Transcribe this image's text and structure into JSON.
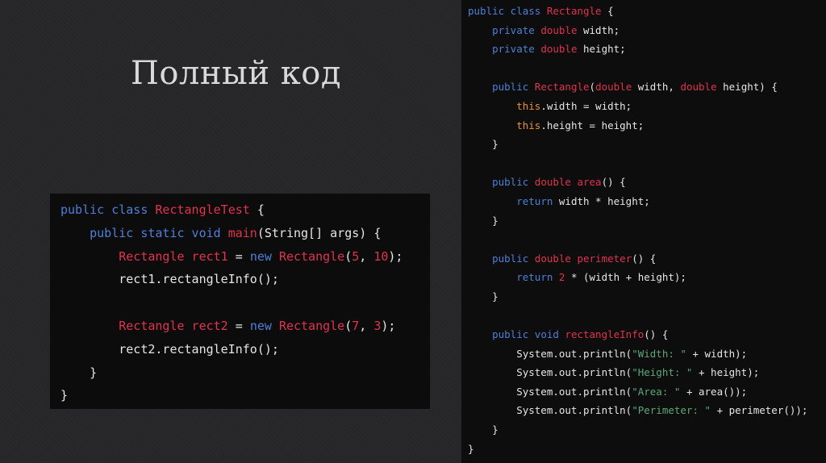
{
  "title": "Полный код",
  "colors": {
    "background": "#262528",
    "panel": "#0c0c0c",
    "keyword": "#4f7fd6",
    "type": "#e0334d",
    "this": "#e8912e",
    "string": "#5aa77a",
    "text": "#e6e6e6"
  },
  "left_code": [
    [
      [
        "kw",
        "public class "
      ],
      [
        "type",
        "RectangleTest"
      ],
      [
        "plain",
        " {"
      ]
    ],
    [
      [
        "plain",
        "    "
      ],
      [
        "kw",
        "public static void "
      ],
      [
        "fn",
        "main"
      ],
      [
        "plain",
        "(String[] args) {"
      ]
    ],
    [
      [
        "plain",
        "        "
      ],
      [
        "type",
        "Rectangle rect1"
      ],
      [
        "plain",
        " = "
      ],
      [
        "kw",
        "new "
      ],
      [
        "type",
        "Rectangle"
      ],
      [
        "plain",
        "("
      ],
      [
        "num",
        "5"
      ],
      [
        "plain",
        ", "
      ],
      [
        "num",
        "10"
      ],
      [
        "plain",
        ");"
      ]
    ],
    [
      [
        "plain",
        "        rect1.rectangleInfo();"
      ]
    ],
    [],
    [
      [
        "plain",
        "        "
      ],
      [
        "type",
        "Rectangle rect2"
      ],
      [
        "plain",
        " = "
      ],
      [
        "kw",
        "new "
      ],
      [
        "type",
        "Rectangle"
      ],
      [
        "plain",
        "("
      ],
      [
        "num",
        "7"
      ],
      [
        "plain",
        ", "
      ],
      [
        "num",
        "3"
      ],
      [
        "plain",
        ");"
      ]
    ],
    [
      [
        "plain",
        "        rect2.rectangleInfo();"
      ]
    ],
    [
      [
        "plain",
        "    }"
      ]
    ],
    [
      [
        "plain",
        "}"
      ]
    ]
  ],
  "right_code": [
    [
      [
        "kw",
        "public class "
      ],
      [
        "type",
        "Rectangle"
      ],
      [
        "plain",
        " {"
      ]
    ],
    [
      [
        "plain",
        "    "
      ],
      [
        "kw",
        "private "
      ],
      [
        "type",
        "double"
      ],
      [
        "plain",
        " width;"
      ]
    ],
    [
      [
        "plain",
        "    "
      ],
      [
        "kw",
        "private "
      ],
      [
        "type",
        "double"
      ],
      [
        "plain",
        " height;"
      ]
    ],
    [],
    [
      [
        "plain",
        "    "
      ],
      [
        "kw",
        "public "
      ],
      [
        "type",
        "Rectangle"
      ],
      [
        "plain",
        "("
      ],
      [
        "type",
        "double"
      ],
      [
        "plain",
        " width, "
      ],
      [
        "type",
        "double"
      ],
      [
        "plain",
        " height) {"
      ]
    ],
    [
      [
        "plain",
        "        "
      ],
      [
        "this",
        "this"
      ],
      [
        "plain",
        ".width = width;"
      ]
    ],
    [
      [
        "plain",
        "        "
      ],
      [
        "this",
        "this"
      ],
      [
        "plain",
        ".height = height;"
      ]
    ],
    [
      [
        "plain",
        "    }"
      ]
    ],
    [],
    [
      [
        "plain",
        "    "
      ],
      [
        "kw",
        "public "
      ],
      [
        "type",
        "double "
      ],
      [
        "fn",
        "area"
      ],
      [
        "plain",
        "() {"
      ]
    ],
    [
      [
        "plain",
        "        "
      ],
      [
        "kw",
        "return"
      ],
      [
        "plain",
        " width * height;"
      ]
    ],
    [
      [
        "plain",
        "    }"
      ]
    ],
    [],
    [
      [
        "plain",
        "    "
      ],
      [
        "kw",
        "public "
      ],
      [
        "type",
        "double "
      ],
      [
        "fn",
        "perimeter"
      ],
      [
        "plain",
        "() {"
      ]
    ],
    [
      [
        "plain",
        "        "
      ],
      [
        "kw",
        "return "
      ],
      [
        "num",
        "2"
      ],
      [
        "plain",
        " * (width + height);"
      ]
    ],
    [
      [
        "plain",
        "    }"
      ]
    ],
    [],
    [
      [
        "plain",
        "    "
      ],
      [
        "kw",
        "public void "
      ],
      [
        "fn",
        "rectangleInfo"
      ],
      [
        "plain",
        "() {"
      ]
    ],
    [
      [
        "plain",
        "        System.out.println("
      ],
      [
        "str",
        "\"Width: \""
      ],
      [
        "plain",
        " + width);"
      ]
    ],
    [
      [
        "plain",
        "        System.out.println("
      ],
      [
        "str",
        "\"Height: \""
      ],
      [
        "plain",
        " + height);"
      ]
    ],
    [
      [
        "plain",
        "        System.out.println("
      ],
      [
        "str",
        "\"Area: \""
      ],
      [
        "plain",
        " + area());"
      ]
    ],
    [
      [
        "plain",
        "        System.out.println("
      ],
      [
        "str",
        "\"Perimeter: \""
      ],
      [
        "plain",
        " + perimeter());"
      ]
    ],
    [
      [
        "plain",
        "    }"
      ]
    ],
    [
      [
        "plain",
        "}"
      ]
    ]
  ]
}
